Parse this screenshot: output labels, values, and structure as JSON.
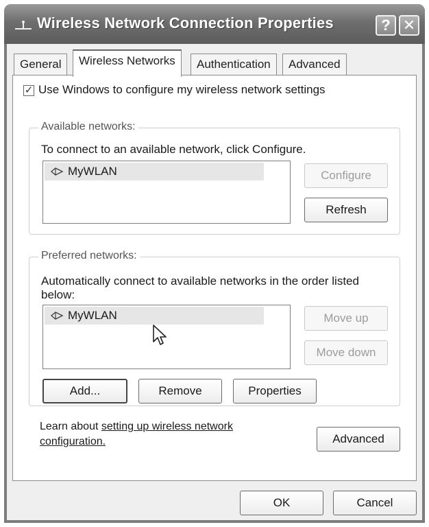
{
  "window": {
    "title": "Wireless Network Connection Properties",
    "help_glyph": "?",
    "close_glyph": "✕"
  },
  "tabs": [
    {
      "label": "General"
    },
    {
      "label": "Wireless Networks",
      "active": true
    },
    {
      "label": "Authentication"
    },
    {
      "label": "Advanced"
    }
  ],
  "config": {
    "checkbox_label": "Use Windows to configure my wireless network settings",
    "checked": true
  },
  "available": {
    "group_title": "Available networks:",
    "description": "To connect to an available network, click Configure.",
    "networks": [
      {
        "name": "MyWLAN"
      }
    ],
    "configure_label": "Configure",
    "refresh_label": "Refresh"
  },
  "preferred": {
    "group_title": "Preferred networks:",
    "description_line1": "Automatically connect to available networks in the order listed",
    "description_line2": "below:",
    "networks": [
      {
        "name": "MyWLAN"
      }
    ],
    "move_up_label": "Move up",
    "move_down_label": "Move down",
    "add_label": "Add...",
    "remove_label": "Remove",
    "properties_label": "Properties"
  },
  "learn": {
    "prefix": "Learn about ",
    "link_line1": "setting up wireless network",
    "link_line2": "configuration.",
    "advanced_label": "Advanced"
  },
  "footer": {
    "ok_label": "OK",
    "cancel_label": "Cancel"
  }
}
